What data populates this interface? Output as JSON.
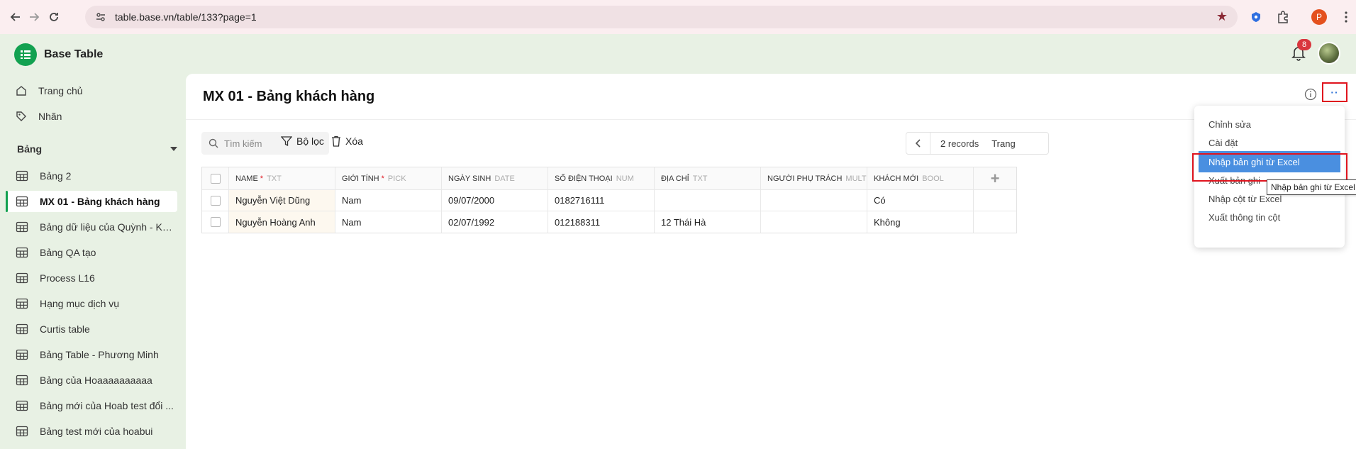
{
  "browser": {
    "url": "table.base.vn/table/133?page=1",
    "profile_initial": "P"
  },
  "app": {
    "name": "Base Table",
    "notification_count": "8"
  },
  "sidebar": {
    "links": [
      {
        "label": "Trang chủ",
        "icon": "home-icon"
      },
      {
        "label": "Nhãn",
        "icon": "tag-icon"
      }
    ],
    "section_title": "Bảng",
    "tables": [
      {
        "label": "Bảng 2"
      },
      {
        "label": "MX 01 - Bảng khách hàng",
        "active": true
      },
      {
        "label": "Bảng dữ liệu của Quỳnh - KH..."
      },
      {
        "label": "Bảng QA tạo"
      },
      {
        "label": "Process L16"
      },
      {
        "label": "Hạng mục dịch vụ"
      },
      {
        "label": "Curtis table"
      },
      {
        "label": "Bảng Table - Phương Minh"
      },
      {
        "label": "Bảng của Hoaaaaaaaaaa"
      },
      {
        "label": "Bảng mới của Hoab test đổi ..."
      },
      {
        "label": "Bảng test mới của hoabui"
      }
    ]
  },
  "page": {
    "title": "MX 01 - Bảng khách hàng",
    "more_label": "··"
  },
  "toolbar": {
    "search_placeholder": "Tìm kiếm",
    "filter_label": "Bộ lọc",
    "delete_label": "Xóa"
  },
  "pager": {
    "count_number": "2",
    "count_suffix": "records",
    "page_label": "Trang"
  },
  "grid": {
    "columns": [
      {
        "name": "NAME",
        "type": "TXT",
        "required": true
      },
      {
        "name": "GIỚI TÍNH",
        "type": "PICK",
        "required": true
      },
      {
        "name": "NGÀY SINH",
        "type": "DATE",
        "required": false
      },
      {
        "name": "SỐ ĐIỆN THOẠI",
        "type": "NUM",
        "required": false
      },
      {
        "name": "ĐỊA CHỈ",
        "type": "TXT",
        "required": false
      },
      {
        "name": "NGƯỜI PHỤ TRÁCH",
        "type": "MULT",
        "required": false
      },
      {
        "name": "KHÁCH MỚI",
        "type": "BOOL",
        "required": false
      }
    ],
    "rows": [
      [
        "Nguyễn Việt Dũng",
        "Nam",
        "09/07/2000",
        "0182716111",
        "",
        "",
        "Có"
      ],
      [
        "Nguyễn Hoàng Anh",
        "Nam",
        "02/07/1992",
        "012188311",
        "12 Thái Hà",
        "",
        "Không"
      ]
    ]
  },
  "menu": {
    "items": [
      {
        "label": "Chỉnh sửa"
      },
      {
        "label": "Cài đặt"
      },
      {
        "label": "Nhập bản ghi từ Excel",
        "highlighted": true
      },
      {
        "label": "Xuất bản ghi"
      },
      {
        "label": "Nhập cột từ Excel"
      },
      {
        "label": "Xuất thông tin cột"
      }
    ],
    "tooltip": "Nhập bản ghi từ Excel"
  },
  "colors": {
    "brand": "#12a150",
    "highlight": "#4a8fe0",
    "annotation_red": "#e0141e",
    "sidebar_bg": "#e8f1e4"
  }
}
